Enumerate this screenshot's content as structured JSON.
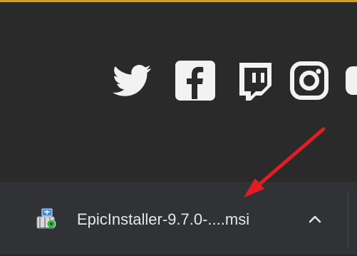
{
  "page": {
    "background": "#2a2a2a",
    "accent_border": "#c9a227",
    "icon_color": "#f2f2f2"
  },
  "social": {
    "icons": [
      "twitter-icon",
      "facebook-icon",
      "twitch-icon",
      "instagram-icon",
      "partial-icon"
    ]
  },
  "download_bar": {
    "background": "#303236",
    "file_name": "EpicInstaller-9.7.0-....msi",
    "file_icon": "msi-installer-icon",
    "toggle_icon": "chevron-up-icon"
  },
  "annotation": {
    "color": "#e11d24",
    "icon": "red-arrow-icon"
  }
}
